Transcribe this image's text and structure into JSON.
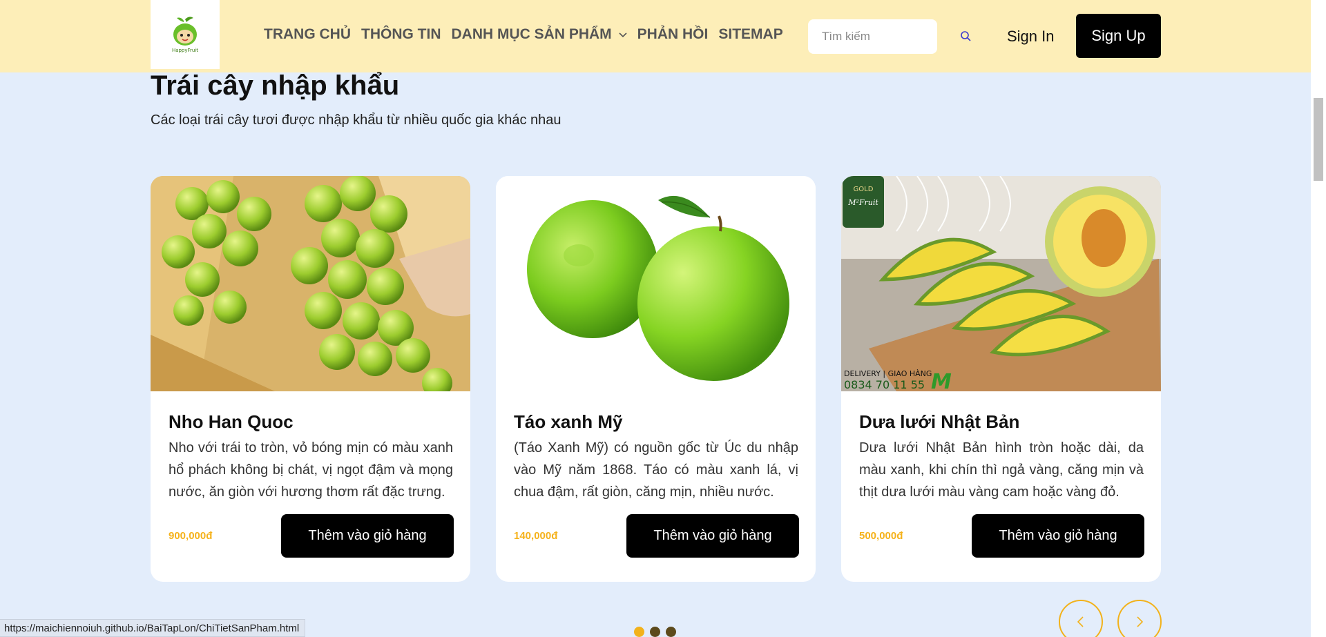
{
  "header": {
    "logo_text": "HappyFruit",
    "nav": [
      {
        "label": "TRANG CHỦ"
      },
      {
        "label": "THÔNG TIN"
      },
      {
        "label": "DANH MỤC SẢN PHẨM"
      },
      {
        "label": "PHẢN HỒI"
      },
      {
        "label": "SITEMAP"
      }
    ],
    "search_placeholder": "Tìm kiếm",
    "signin_label": "Sign In",
    "signup_label": "Sign Up"
  },
  "section": {
    "title": "Trái cây nhập khẩu",
    "subtitle": "Các loại trái cây tươi được nhập khẩu từ nhiều quốc gia khác nhau"
  },
  "products": [
    {
      "name": "Nho Han Quoc",
      "description": "Nho với trái to tròn, vỏ bóng mịn có màu xanh hổ phách không bị chát, vị ngọt đậm và mọng nước, ăn giòn với hương thơm rất đặc trưng.",
      "price": "900,000đ",
      "button_label": "Thêm vào giỏ hàng"
    },
    {
      "name": "Táo xanh Mỹ",
      "description": "(Táo Xanh Mỹ) có nguồn gốc từ Úc du nhập vào Mỹ năm 1868. Táo có màu xanh lá, vị chua đậm, rất giòn, căng mịn, nhiều nước.",
      "price": "140,000đ",
      "button_label": "Thêm vào giỏ hàng"
    },
    {
      "name": "Dưa lưới Nhật Bản",
      "description": "Dưa lưới Nhật Bản hình tròn hoặc dài, da màu xanh, khi chín thì ngả vàng, căng mịn và thịt dưa lưới màu vàng cam hoặc vàng đỏ.",
      "price": "500,000đ",
      "button_label": "Thêm vào giỏ hàng",
      "image_text": {
        "badge": "GOLD",
        "brand": "M²Fruit",
        "delivery": "DELIVERY | GIAO HÀNG",
        "phone": "0834 70 11 55",
        "logo": "M"
      }
    }
  ],
  "carousel": {
    "dots": [
      {
        "color": "#f2b21b"
      },
      {
        "color": "#5c4a1c"
      },
      {
        "color": "#5c4a1c"
      }
    ]
  },
  "status_url": "https://maichiennoiuh.github.io/BaiTapLon/ChiTietSanPham.html",
  "colors": {
    "header_bg": "#fdeeb8",
    "page_bg": "#e3edfb",
    "accent": "#f2b21b",
    "button_bg": "#000000"
  }
}
